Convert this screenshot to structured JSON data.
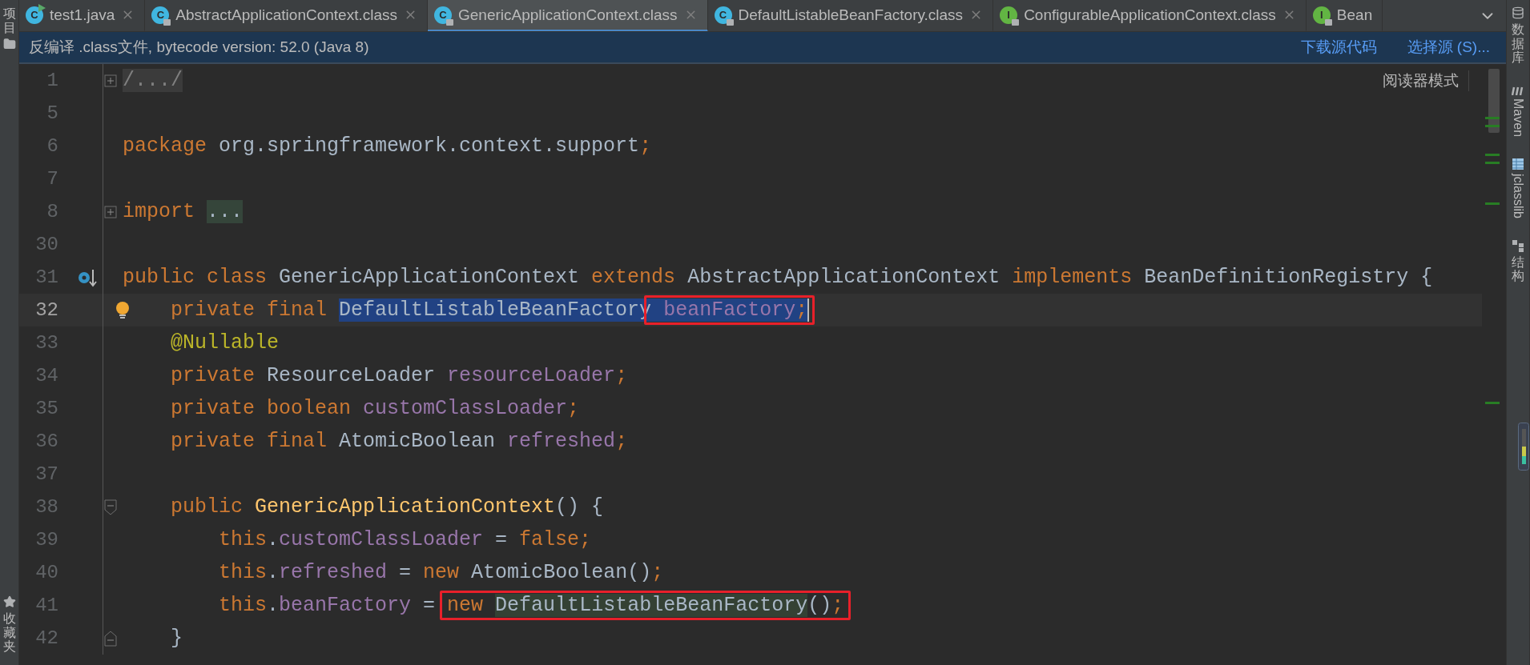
{
  "left_toolbar": [
    {
      "label": "项目"
    },
    {
      "label": "收藏夹"
    }
  ],
  "tabs": [
    {
      "label": "test1.java",
      "icon_letter": "C",
      "kind": "runnable",
      "locked": false,
      "selected": false,
      "closable": true
    },
    {
      "label": "AbstractApplicationContext.class",
      "icon_letter": "C",
      "kind": "class",
      "locked": true,
      "selected": false,
      "closable": true
    },
    {
      "label": "GenericApplicationContext.class",
      "icon_letter": "C",
      "kind": "class",
      "locked": true,
      "selected": true,
      "closable": true
    },
    {
      "label": "DefaultListableBeanFactory.class",
      "icon_letter": "C",
      "kind": "class",
      "locked": true,
      "selected": false,
      "closable": true
    },
    {
      "label": "ConfigurableApplicationContext.class",
      "icon_letter": "I",
      "kind": "interface",
      "locked": true,
      "selected": false,
      "closable": true
    },
    {
      "label": "Bean",
      "icon_letter": "I",
      "kind": "interface",
      "locked": true,
      "selected": false,
      "closable": false
    }
  ],
  "notice": {
    "text": "反编译 .class文件, bytecode version: 52.0 (Java 8)",
    "links": [
      "下载源代码",
      "选择源 (S)..."
    ]
  },
  "reader_mode": "阅读器模式",
  "lines": [
    {
      "number": "1",
      "kind": "collapsed",
      "current": false,
      "tokens": [
        {
          "text": "/.../",
          "kind": "folded"
        }
      ]
    },
    {
      "number": "5",
      "kind": "plain",
      "current": false
    },
    {
      "number": "6",
      "kind": "plain",
      "current": false,
      "tokens": [
        {
          "text": "package",
          "kind": "keyword"
        },
        {
          "text": " org.springframework.context.support",
          "kind": "plain"
        },
        {
          "text": ";",
          "kind": "keyword"
        }
      ]
    },
    {
      "number": "7",
      "kind": "plain",
      "current": false
    },
    {
      "number": "8",
      "kind": "collapsed",
      "current": false,
      "tokens": [
        {
          "text": "import ",
          "kind": "keyword"
        },
        {
          "text": "...",
          "kind": "folded_code"
        }
      ]
    },
    {
      "number": "30",
      "kind": "plain",
      "current": false
    },
    {
      "number": "31",
      "kind": "override",
      "current": false,
      "tokens": [
        {
          "text": "public class",
          "kind": "keyword"
        },
        {
          "text": " GenericApplicationContext ",
          "kind": "plain"
        },
        {
          "text": "extends",
          "kind": "keyword"
        },
        {
          "text": " AbstractApplicationContext ",
          "kind": "plain"
        },
        {
          "text": "implements",
          "kind": "keyword"
        },
        {
          "text": " BeanDefinitionRegistry {",
          "kind": "plain"
        }
      ]
    },
    {
      "number": "32",
      "kind": "intention",
      "current": true,
      "caret": true,
      "tokens": [
        {
          "text": "    private final ",
          "kind": "keyword"
        },
        {
          "text": "DefaultListableBeanFactory",
          "kind": "plain",
          "in_selection": true
        },
        {
          "kind": "annotation_box",
          "tokens": [
            {
              "text": " beanFactory",
              "kind": "field",
              "in_selection": true
            },
            {
              "text": ";",
              "kind": "keyword",
              "in_selection": true
            }
          ]
        }
      ]
    },
    {
      "number": "33",
      "kind": "plain",
      "current": false,
      "tokens": [
        {
          "text": "    @Nullable",
          "kind": "annotation"
        }
      ]
    },
    {
      "number": "34",
      "kind": "plain",
      "current": false,
      "tokens": [
        {
          "text": "    private",
          "kind": "keyword"
        },
        {
          "text": " ResourceLoader ",
          "kind": "plain"
        },
        {
          "text": "resourceLoader",
          "kind": "field"
        },
        {
          "text": ";",
          "kind": "keyword"
        }
      ]
    },
    {
      "number": "35",
      "kind": "plain",
      "current": false,
      "tokens": [
        {
          "text": "    private boolean ",
          "kind": "keyword"
        },
        {
          "text": "customClassLoader",
          "kind": "field"
        },
        {
          "text": ";",
          "kind": "keyword"
        }
      ]
    },
    {
      "number": "36",
      "kind": "plain",
      "current": false,
      "tokens": [
        {
          "text": "    private final",
          "kind": "keyword"
        },
        {
          "text": " AtomicBoolean ",
          "kind": "plain"
        },
        {
          "text": "refreshed",
          "kind": "field"
        },
        {
          "text": ";",
          "kind": "keyword"
        }
      ]
    },
    {
      "number": "37",
      "kind": "plain",
      "current": false
    },
    {
      "number": "38",
      "kind": "block_start",
      "current": false,
      "tokens": [
        {
          "text": "    public ",
          "kind": "keyword"
        },
        {
          "text": "GenericApplicationContext",
          "kind": "method"
        },
        {
          "text": "() {",
          "kind": "plain"
        }
      ]
    },
    {
      "number": "39",
      "kind": "plain",
      "current": false,
      "tokens": [
        {
          "text": "        this",
          "kind": "keyword"
        },
        {
          "text": ".",
          "kind": "plain"
        },
        {
          "text": "customClassLoader",
          "kind": "field"
        },
        {
          "text": " = ",
          "kind": "plain"
        },
        {
          "text": "false;",
          "kind": "keyword"
        }
      ]
    },
    {
      "number": "40",
      "kind": "plain",
      "current": false,
      "tokens": [
        {
          "text": "        this",
          "kind": "keyword"
        },
        {
          "text": ".",
          "kind": "plain"
        },
        {
          "text": "refreshed",
          "kind": "field"
        },
        {
          "text": " = ",
          "kind": "plain"
        },
        {
          "text": "new",
          "kind": "keyword"
        },
        {
          "text": " AtomicBoolean()",
          "kind": "plain"
        },
        {
          "text": ";",
          "kind": "keyword"
        }
      ]
    },
    {
      "number": "41",
      "kind": "plain",
      "current": false,
      "tokens": [
        {
          "text": "        this",
          "kind": "keyword"
        },
        {
          "text": ".",
          "kind": "plain"
        },
        {
          "text": "beanFactory",
          "kind": "field"
        },
        {
          "text": " = ",
          "kind": "plain"
        },
        {
          "kind": "annotation_box",
          "tokens": [
            {
              "text": "new ",
              "kind": "keyword"
            },
            {
              "text": "DefaultListableBeanFactory",
              "kind": "plain",
              "usage_highlight": true
            },
            {
              "text": "()",
              "kind": "plain"
            },
            {
              "text": ";",
              "kind": "keyword"
            }
          ]
        }
      ]
    },
    {
      "number": "42",
      "kind": "block_end",
      "current": false,
      "tokens": [
        {
          "text": "    }",
          "kind": "plain"
        }
      ]
    }
  ],
  "right_toolbar": [
    {
      "label": "数据库",
      "kind": "cjk"
    },
    {
      "label": "Maven",
      "kind": "latin"
    },
    {
      "label": "jclasslib",
      "kind": "latin"
    },
    {
      "label": "结构",
      "kind": "cjk"
    }
  ]
}
